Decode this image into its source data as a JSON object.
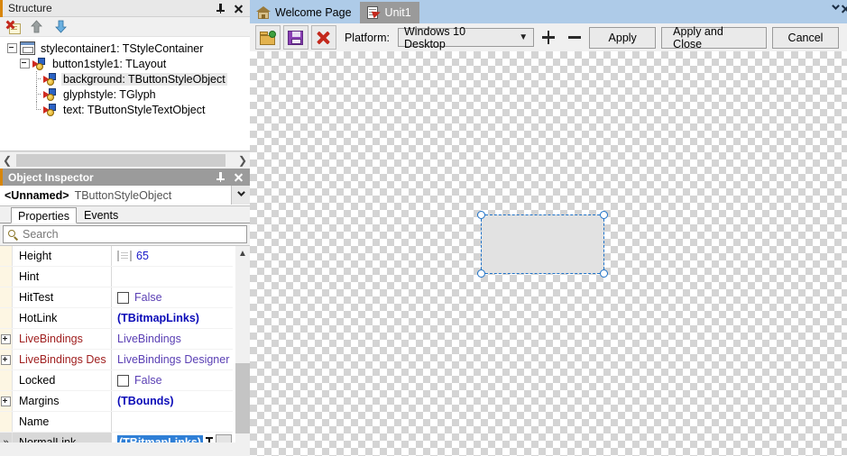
{
  "structure_panel": {
    "title": "Structure",
    "pin_icon": "pin-icon",
    "close_icon": "close-icon",
    "toolbar": [
      {
        "icon": "delete-note-icon",
        "label": "Delete"
      },
      {
        "icon": "arrow-up-icon",
        "label": "Move Up"
      },
      {
        "icon": "arrow-down-icon",
        "label": "Move Down"
      }
    ],
    "tree": [
      {
        "label": "stylecontainer1: TStyleContainer",
        "depth": 0,
        "icon": "style-container-icon",
        "expander": "minus",
        "selected": false
      },
      {
        "label": "button1style1: TLayout",
        "depth": 1,
        "icon": "component-icon",
        "expander": "minus",
        "selected": false
      },
      {
        "label": "background: TButtonStyleObject",
        "depth": 2,
        "icon": "component-icon",
        "expander": "none",
        "selected": true
      },
      {
        "label": "glyphstyle: TGlyph",
        "depth": 2,
        "icon": "component-icon",
        "expander": "none",
        "selected": false
      },
      {
        "label": "text: TButtonStyleTextObject",
        "depth": 2,
        "icon": "component-icon",
        "expander": "none",
        "selected": false
      }
    ],
    "hscroll": {
      "left_icon": "chevron-left-icon",
      "right_icon": "chevron-right-icon"
    }
  },
  "object_inspector": {
    "title": "Object Inspector",
    "pin_icon": "pin-icon",
    "close_icon": "close-icon",
    "selected_object": {
      "name": "<Unnamed>",
      "class": "TButtonStyleObject",
      "dropdown_icon": "chevron-down-icon"
    },
    "tabs": [
      {
        "label": "Properties",
        "active": true
      },
      {
        "label": "Events",
        "active": false
      }
    ],
    "search": {
      "placeholder": "Search",
      "icon": "search-icon",
      "value": ""
    },
    "properties": [
      {
        "name": "Height",
        "value": "65",
        "value_style": "blue",
        "expander": "none",
        "icon": "ruler-icon",
        "checkbox": false,
        "selected": false
      },
      {
        "name": "Hint",
        "value": "",
        "value_style": "plain",
        "expander": "none",
        "icon": "none",
        "checkbox": false,
        "selected": false
      },
      {
        "name": "HitTest",
        "value": "False",
        "value_style": "purple",
        "expander": "none",
        "icon": "none",
        "checkbox": true,
        "selected": false
      },
      {
        "name": "HotLink",
        "value": "(TBitmapLinks)",
        "value_style": "boldblue",
        "expander": "none",
        "icon": "none",
        "checkbox": false,
        "selected": false
      },
      {
        "name": "LiveBindings",
        "value": "LiveBindings",
        "value_style": "purple",
        "name_style": "red",
        "expander": "plus",
        "icon": "none",
        "checkbox": false,
        "selected": false
      },
      {
        "name": "LiveBindings Des",
        "value": "LiveBindings Designer",
        "value_style": "purple",
        "name_style": "red",
        "expander": "plus",
        "icon": "none",
        "checkbox": false,
        "selected": false
      },
      {
        "name": "Locked",
        "value": "False",
        "value_style": "purple",
        "expander": "none",
        "icon": "none",
        "checkbox": true,
        "selected": false
      },
      {
        "name": "Margins",
        "value": "(TBounds)",
        "value_style": "boldblue",
        "expander": "plus",
        "icon": "none",
        "checkbox": false,
        "selected": false
      },
      {
        "name": "Name",
        "value": "",
        "value_style": "plain",
        "expander": "none",
        "icon": "none",
        "checkbox": false,
        "selected": false
      },
      {
        "name": "NormalLink",
        "value": "(TBitmapLinks)",
        "value_style": "selected",
        "expander": "more",
        "icon": "none",
        "checkbox": false,
        "selected": true,
        "ellipsis_label": "..."
      }
    ],
    "scrollbar": {
      "up_icon": "scroll-up-icon"
    }
  },
  "designer": {
    "tabs": [
      {
        "label": "Welcome Page",
        "icon": "home-icon",
        "active": false
      },
      {
        "label": "Unit1",
        "icon": "unit-file-icon",
        "active": true
      }
    ],
    "window_buttons": [
      {
        "icon": "chevron-down-icon",
        "name": "minimize-dropdown"
      },
      {
        "icon": "close-icon",
        "name": "close"
      }
    ],
    "toolbar": {
      "open_icon": "open-folder-icon",
      "save_icon": "save-disk-icon",
      "delete_icon": "delete-red-x-icon",
      "platform_label": "Platform:",
      "platform_value": "Windows 10 Desktop",
      "platform_dropdown_icon": "chevron-down-icon",
      "add_icon": "plus-icon",
      "remove_icon": "minus-icon",
      "buttons": [
        {
          "label": "Apply",
          "name": "apply-button"
        },
        {
          "label": "Apply and Close",
          "name": "apply-and-close-button"
        },
        {
          "label": "Cancel",
          "name": "cancel-button"
        }
      ]
    },
    "canvas": {
      "selection": {
        "fill_color": "#e2e2e2",
        "border_color": "#1e72c8",
        "handles": 4
      }
    }
  },
  "colors": {
    "tab_bar": "#aecbe8",
    "active_tab": "#9a9a9a",
    "inspector_header": "#9b9b9b",
    "accent_orange": "#d8860b",
    "selection_blue": "#2f7fd6"
  }
}
